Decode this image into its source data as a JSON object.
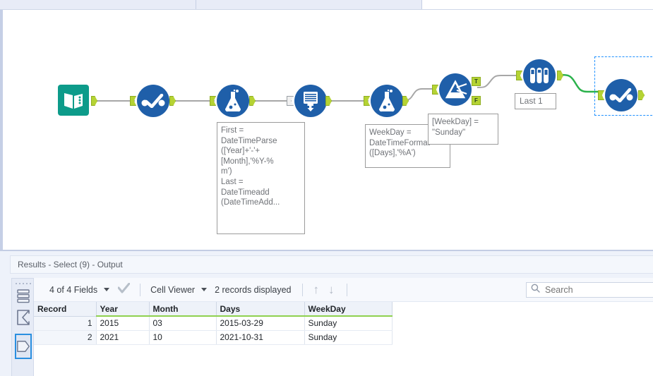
{
  "window": {
    "toolbar_partial": true
  },
  "canvas": {
    "nodes": [
      {
        "id": "text-input",
        "icon": "book-icon",
        "label": ""
      },
      {
        "id": "select-1",
        "icon": "select-check-icon",
        "label": ""
      },
      {
        "id": "formula-1",
        "icon": "flask-icon",
        "label": ""
      },
      {
        "id": "generate-rows",
        "icon": "generate-rows-icon",
        "label": ""
      },
      {
        "id": "formula-2",
        "icon": "flask-icon",
        "label": ""
      },
      {
        "id": "filter",
        "icon": "filter-funnel-icon",
        "label": ""
      },
      {
        "id": "sample",
        "icon": "test-tubes-icon",
        "label": "Last 1"
      },
      {
        "id": "select-2",
        "icon": "select-check-icon",
        "label": ""
      }
    ],
    "filter_outputs": {
      "true_label": "T",
      "false_label": "F"
    },
    "annotations": [
      {
        "id": "formula-1-annotation",
        "text": "First =\nDateTimeParse\n([Year]+'-'+\n[Month],'%Y-%\nm')\nLast =\nDateTimeadd\n(DateTimeAdd..."
      },
      {
        "id": "formula-2-annotation",
        "text": "WeekDay =\nDateTimeFormat\n([Days],'%A')"
      },
      {
        "id": "filter-annotation",
        "text": "[WeekDay] =\n\"Sunday\""
      }
    ],
    "sample_label": "Last 1",
    "colors": {
      "tool_blue": "#1f5fa9",
      "input_teal": "#0d9b8a",
      "anchor_green": "#b5d334",
      "wire_grey": "#a7a7a7",
      "wire_active_green": "#2bb24c",
      "selection_blue": "#1e90ff"
    }
  },
  "results": {
    "title": "Results - Select (9) - Output",
    "rail_icons": [
      {
        "name": "records-list-icon",
        "selected": false
      },
      {
        "name": "summary-sigma-icon",
        "selected": false
      },
      {
        "name": "metadata-pentagon-icon",
        "selected": true
      }
    ],
    "toolbar": {
      "fields_label": "4 of 4 Fields",
      "checkmark_icon": "checkmark-icon",
      "view_mode": "Cell Viewer",
      "records_label": "2 records displayed",
      "up_arrow": "↑",
      "down_arrow": "↓"
    },
    "search": {
      "placeholder": "Search",
      "value": "",
      "icon": "search-icon"
    },
    "table": {
      "columns": [
        "Record",
        "Year",
        "Month",
        "Days",
        "WeekDay"
      ],
      "rows": [
        {
          "record": "1",
          "year": "2015",
          "month": "03",
          "days": "2015-03-29",
          "weekday": "Sunday"
        },
        {
          "record": "2",
          "year": "2021",
          "month": "10",
          "days": "2021-10-31",
          "weekday": "Sunday"
        }
      ]
    }
  }
}
